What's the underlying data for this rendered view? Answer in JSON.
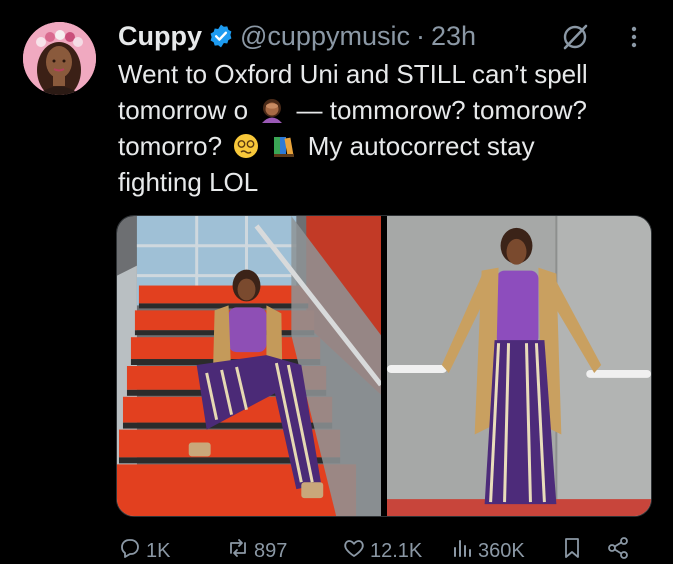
{
  "author": {
    "name": "Cuppy",
    "handle": "@cuppymusic",
    "separator": "·",
    "time": "23h"
  },
  "tweet": {
    "line1": "Went to Oxford Uni and STILL can’t spell",
    "line2_a": "tomorrow o",
    "line2_b": "— tommorow? tomorow?",
    "line3_a": "tomorro?",
    "line3_b": "My autocorrect stay",
    "line4": "fighting LOL"
  },
  "stats": {
    "replies": "1K",
    "reposts": "897",
    "likes": "12.1K",
    "views": "360K"
  },
  "icons": {
    "verified": "verified-badge-icon",
    "grok": "grok-icon",
    "more": "more-options-icon",
    "reply": "reply-icon",
    "repost": "repost-icon",
    "like": "like-icon",
    "views": "views-icon",
    "bookmark": "bookmark-icon",
    "share": "share-icon"
  },
  "colors": {
    "background": "#000000",
    "text": "#e7e9ea",
    "muted": "#8b98a5",
    "verified": "#1d9bf0"
  }
}
